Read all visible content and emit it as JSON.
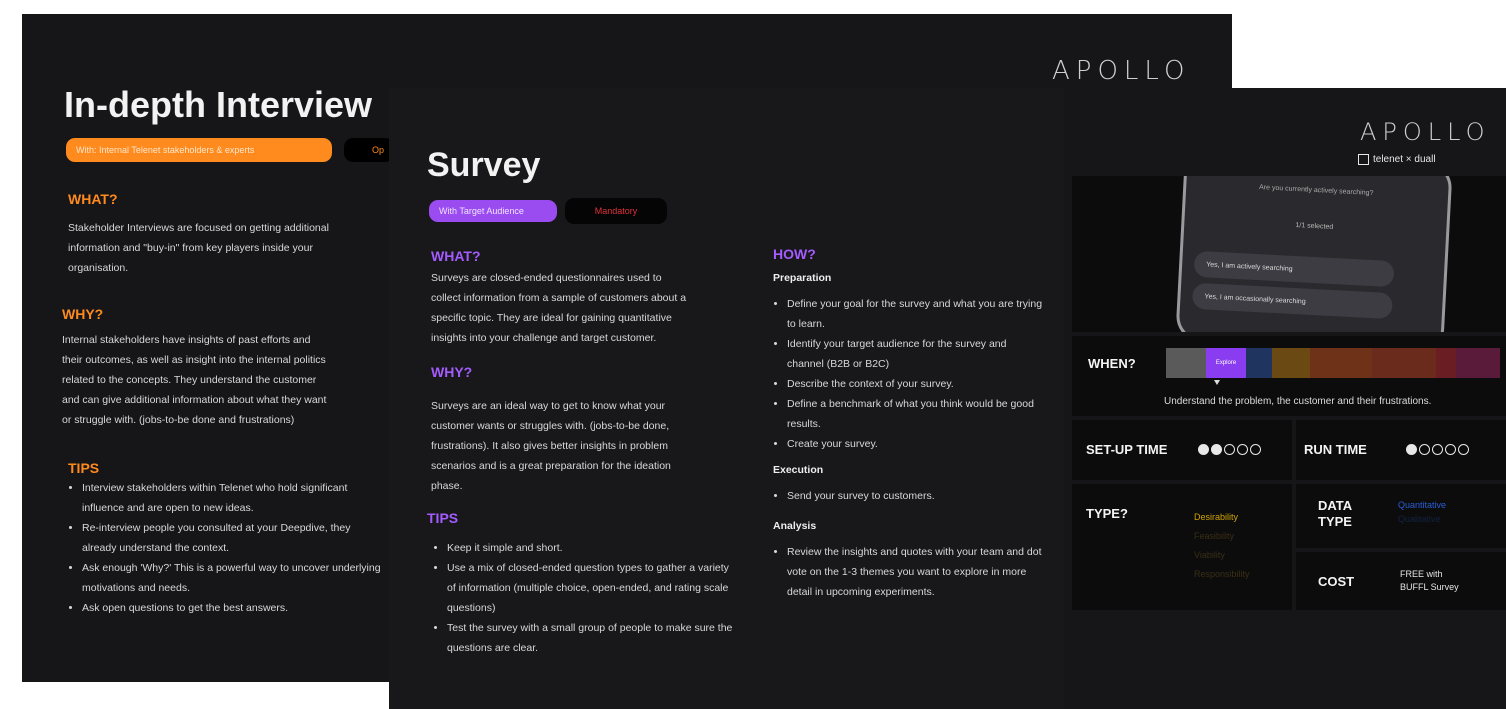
{
  "interview": {
    "logo": "APOLLO",
    "title": "In-depth Interview",
    "tag_audience": "With: Internal Telenet stakeholders & experts",
    "tag_mode": "Op",
    "what_label": "WHAT?",
    "what_lines": [
      "Stakeholder Interviews are focused on getting additional",
      "information and \"buy-in\" from key players inside your",
      "organisation."
    ],
    "why_label": "WHY?",
    "why_lines": [
      "Internal stakeholders have insights of past efforts and",
      "their outcomes, as well as insight into the internal politics",
      "related to the concepts. They understand the customer",
      "and can give additional information about what they want",
      "or struggle with. (jobs-to-be done and frustrations)"
    ],
    "tips_label": "TIPS",
    "tips": [
      "Interview stakeholders within Telenet who hold significant influence and are open to new ideas.",
      "Re-interview people you consulted at your Deepdive, they already understand the context.",
      "Ask enough 'Why?' This is a powerful way to uncover underlying motivations and needs.",
      "Ask open questions to get the best answers."
    ]
  },
  "survey": {
    "title": "Survey",
    "tag_audience": "With Target Audience",
    "tag_mode": "Mandatory",
    "what_label": "WHAT?",
    "what_lines": [
      "Surveys are closed-ended questionnaires used to",
      "collect information from a sample of customers about a",
      "specific topic. They are ideal for gaining quantitative",
      "insights into your challenge and target customer."
    ],
    "why_label": "WHY?",
    "why_lines": [
      "Surveys are an ideal way to get to know what your",
      "customer wants or struggles with. (jobs-to-be done,",
      "frustrations). It also gives better insights in problem",
      "scenarios and is a great preparation for the ideation",
      "phase."
    ],
    "tips_label": "TIPS",
    "tips": [
      "Keep it simple and short.",
      "Use a mix of closed-ended question types to gather a variety of information (multiple choice, open-ended, and rating scale questions)",
      "Test the survey with a small group of people to make sure the questions are clear."
    ],
    "how_label": "HOW?",
    "prep_label": "Preparation",
    "prep_items": [
      "Define your goal for the survey and what you are trying to learn.",
      "Identify your target audience for the survey and channel (B2B or B2C)",
      "Describe the context of your survey.",
      "Define a benchmark of what you think would be good results.",
      "Create your survey."
    ],
    "exec_label": "Execution",
    "exec_items": [
      "Send your survey to customers."
    ],
    "analysis_label": "Analysis",
    "analysis_items": [
      "Review the insights and quotes with your team and dot vote on the 1-3 themes you want to explore in more detail in upcoming experiments."
    ]
  },
  "panel": {
    "logo": "APOLLO",
    "partners": "telenet × duall",
    "phone_question": "Are you currently actively searching?",
    "phone_selected": "1/1 selected",
    "phone_option1": "Yes, I am actively searching",
    "phone_option2": "Yes, I am occasionally searching",
    "when_label": "WHEN?",
    "when_active": "Explore",
    "when_caption": "Understand the problem, the customer and their frustrations.",
    "setup_label": "SET-UP TIME",
    "setup_level": 2,
    "run_label": "RUN TIME",
    "run_level": 1,
    "type_label": "TYPE?",
    "type_items": [
      "Desirability",
      "Feasibility",
      "Viability",
      "Responsibility"
    ],
    "data_type_label": "DATA TYPE",
    "data_type_items": [
      "Quantitative",
      "Qualitative"
    ],
    "cost_label": "COST",
    "cost_value_line1": "FREE with",
    "cost_value_line2": "BUFFL Survey"
  },
  "colors": {
    "orange": "#ff8a1e",
    "purple": "#a45bff",
    "mandatory_red": "#e0343a",
    "desirability": "#d0a300"
  }
}
